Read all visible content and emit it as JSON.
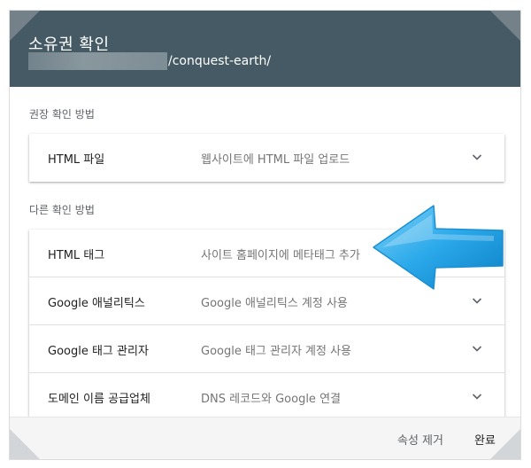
{
  "dialog": {
    "title": "소유권 확인",
    "url_suffix": "/conquest-earth/"
  },
  "recommended": {
    "label": "권장 확인 방법",
    "methods": [
      {
        "name": "HTML 파일",
        "description": "웹사이트에 HTML 파일 업로드",
        "expanded": false
      }
    ]
  },
  "alternate": {
    "label": "다른 확인 방법",
    "methods": [
      {
        "name": "HTML 태그",
        "description": "사이트 홈페이지에 메타태그 추가",
        "expanded": false
      },
      {
        "name": "Google 애널리틱스",
        "description": "Google 애널리틱스 계정 사용",
        "expanded": false
      },
      {
        "name": "Google 태그 관리자",
        "description": "Google 태그 관리자 계정 사용",
        "expanded": false
      },
      {
        "name": "도메인 이름 공급업체",
        "description": "DNS 레코드와 Google 연결",
        "expanded": false
      }
    ]
  },
  "footer": {
    "remove_label": "속성 제거",
    "done_label": "완료"
  },
  "colors": {
    "header_bg": "#455a64",
    "annotation_arrow": "#29a8ea"
  }
}
